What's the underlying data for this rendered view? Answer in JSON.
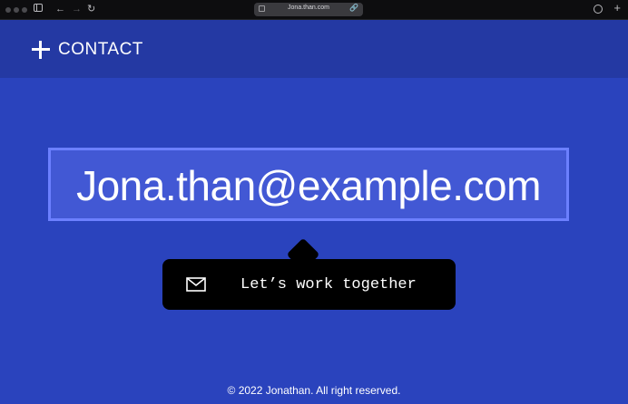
{
  "browser": {
    "url": "Jona.than.com",
    "icons": [
      "sidebar-icon",
      "back-icon",
      "forward-icon",
      "reload-icon",
      "lock-icon",
      "link-icon",
      "download-icon",
      "new-tab-icon"
    ]
  },
  "header": {
    "title": "CONTACT",
    "icon": "plus-icon"
  },
  "main": {
    "email": "Jona.than@example.com"
  },
  "tooltip": {
    "label": "Let’s work together",
    "icon": "mail-icon"
  },
  "footer": {
    "copyright": "© 2022 Jonathan. All right reserved."
  },
  "colors": {
    "background": "#2a43bd",
    "header": "#2439a3",
    "email_box": "#4258d4",
    "email_border": "#6c80ff",
    "tooltip": "#000000"
  }
}
